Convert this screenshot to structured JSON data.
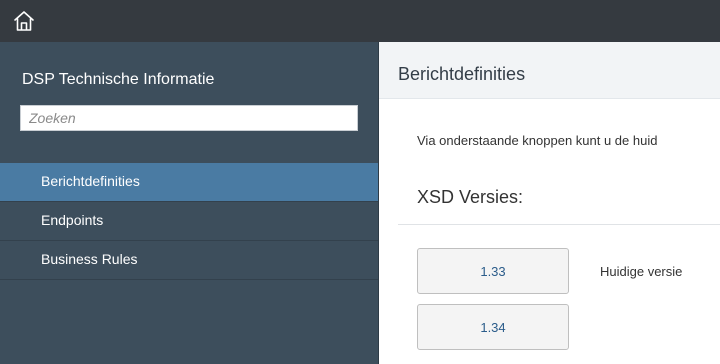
{
  "header": {
    "home_icon": "home-icon"
  },
  "sidebar": {
    "title": "DSP Technische Informatie",
    "search_placeholder": "Zoeken",
    "items": [
      {
        "label": "Berichtdefinities",
        "active": true
      },
      {
        "label": "Endpoints",
        "active": false
      },
      {
        "label": "Business Rules",
        "active": false
      }
    ]
  },
  "main": {
    "title": "Berichtdefinities",
    "intro": "Via onderstaande knoppen kunt u de huid",
    "section_title": "XSD Versies:",
    "versions": [
      {
        "label": "1.33",
        "note": "Huidige versie"
      },
      {
        "label": "1.34",
        "note": ""
      }
    ]
  },
  "colors": {
    "topbar": "#353a40",
    "sidebar": "#3d4e5c",
    "active_item": "#4a7ba3",
    "header": "#f2f4f6"
  }
}
